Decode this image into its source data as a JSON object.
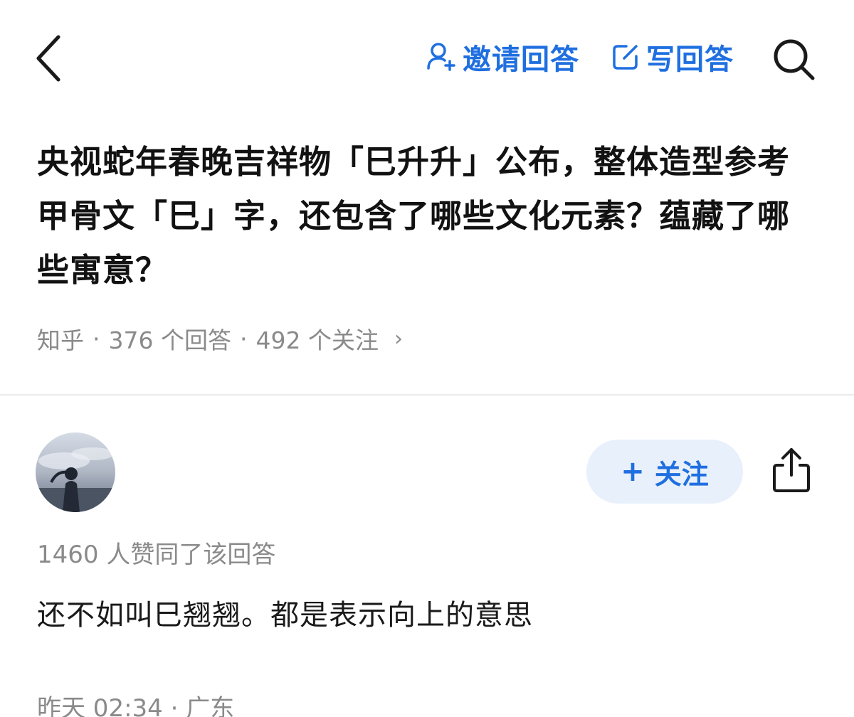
{
  "header": {
    "invite_label": "邀请回答",
    "write_label": "写回答",
    "icons": {
      "back": "chevron-left-icon",
      "invite": "person-add-icon",
      "write": "edit-icon",
      "search": "search-icon"
    },
    "accent_color": "#1f6fe0"
  },
  "question": {
    "title": "央视蛇年春晚吉祥物「巳升升」公布，整体造型参考甲骨文「巳」字，还包含了哪些文化元素？蕴藏了哪些寓意？",
    "source": "知乎",
    "answers_count": "376 个回答",
    "followers_count": "492 个关注",
    "separator": "·",
    "chevron": "›"
  },
  "answer": {
    "follow_label": "关注",
    "follow_icon": "+",
    "vote_text": "1460 人赞同了该回答",
    "content": "还不如叫巳翘翘。都是表示向上的意思",
    "meta_text": "昨天 02:34 · 广东",
    "icons": {
      "avatar": "avatar",
      "share": "share-icon"
    }
  }
}
